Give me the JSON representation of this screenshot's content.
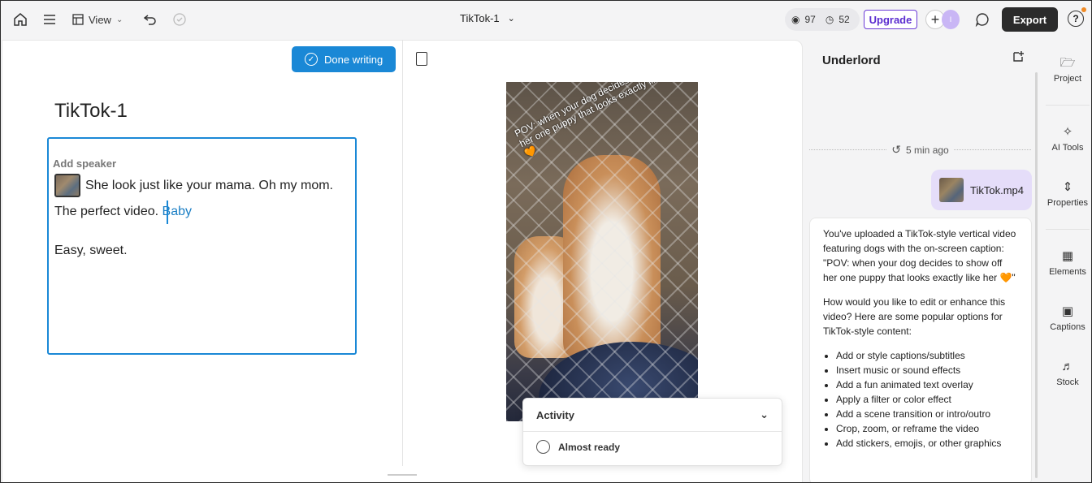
{
  "toolbar": {
    "view_label": "View",
    "doc_title": "TikTok-1",
    "credits_a": "97",
    "credits_b": "52",
    "upgrade_label": "Upgrade",
    "avatar_initial": "I",
    "export_label": "Export",
    "help_label": "?"
  },
  "editor": {
    "done_label": "Done writing",
    "title": "TikTok-1",
    "add_speaker": "Add speaker",
    "line1": "She look just like your mama. Oh my mom.",
    "line2_plain": "The perfect video. ",
    "line2_highlight": "Baby",
    "line3": "Easy, sweet."
  },
  "video": {
    "caption": "POV: when your dog decides to show off her one puppy that looks exactly like her 🧡"
  },
  "activity": {
    "title": "Activity",
    "status": "Almost ready"
  },
  "underlord": {
    "title": "Underlord",
    "timestamp": "5 min ago",
    "file_name": "TikTok.mp4",
    "para1": "You've uploaded a TikTok-style vertical video featuring dogs with the on-screen caption:",
    "para1_quote": "\"POV: when your dog decides to show off her one puppy that looks exactly like her 🧡\"",
    "para2": "How would you like to edit or enhance this video? Here are some popular options for TikTok-style content:",
    "options": [
      "Add or style captions/subtitles",
      "Insert music or sound effects",
      "Add a fun animated text overlay",
      "Apply a filter or color effect",
      "Add a scene transition or intro/outro",
      "Crop, zoom, or reframe the video",
      "Add stickers, emojis, or other graphics"
    ]
  },
  "rail": {
    "project": "Project",
    "ai_tools": "AI Tools",
    "properties": "Properties",
    "elements": "Elements",
    "captions": "Captions",
    "stock": "Stock"
  }
}
